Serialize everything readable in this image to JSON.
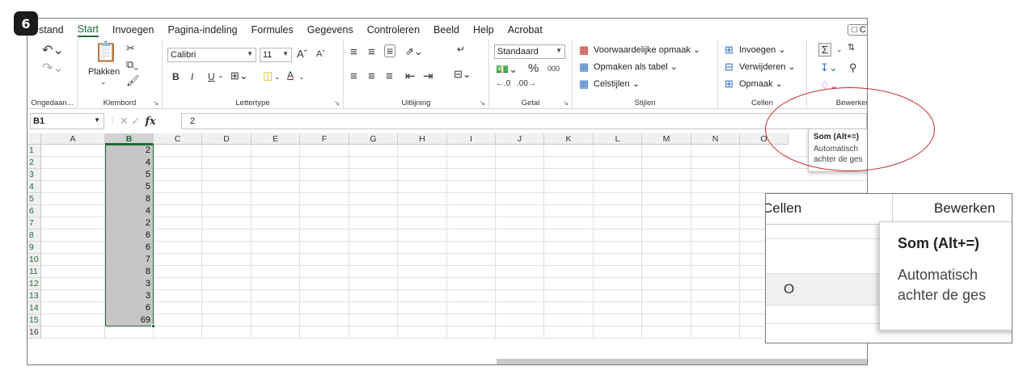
{
  "step_badge": "6",
  "tabs": [
    {
      "label": "stand"
    },
    {
      "label": "Start"
    },
    {
      "label": "Invoegen"
    },
    {
      "label": "Pagina-indeling"
    },
    {
      "label": "Formules"
    },
    {
      "label": "Gegevens"
    },
    {
      "label": "Controleren"
    },
    {
      "label": "Beeld"
    },
    {
      "label": "Help"
    },
    {
      "label": "Acrobat"
    }
  ],
  "comment_button": "C",
  "ribbon": {
    "undo_label": "Ongedaan...",
    "clipboard": {
      "paste_label": "Plakken",
      "group_label": "Klembord"
    },
    "font": {
      "name": "Calibri",
      "size": "11",
      "bold": "B",
      "italic": "I",
      "underline": "U",
      "font_color_letter": "A",
      "group_label": "Lettertype"
    },
    "alignment": {
      "group_label": "Uitlijning"
    },
    "number": {
      "format": "Standaard",
      "percent": "%",
      "thousands": "000",
      "group_label": "Getal"
    },
    "styles": {
      "conditional": "Voorwaardelijke opmaak",
      "as_table": "Opmaken als tabel",
      "cell_styles": "Celstijlen",
      "group_label": "Stijlen"
    },
    "cells": {
      "insert": "Invoegen",
      "delete": "Verwijderen",
      "format": "Opmaak",
      "group_label": "Cellen"
    },
    "editing": {
      "group_label": "Bewerken",
      "sum_symbol": "Σ"
    }
  },
  "formula_bar": {
    "name_box": "B1",
    "fx": "fx",
    "value": "2"
  },
  "columns": [
    "A",
    "B",
    "C",
    "D",
    "E",
    "F",
    "G",
    "H",
    "I",
    "J",
    "K",
    "L",
    "M",
    "N",
    "O"
  ],
  "rows": [
    "1",
    "2",
    "3",
    "4",
    "5",
    "6",
    "7",
    "8",
    "9",
    "10",
    "11",
    "12",
    "13",
    "14",
    "15",
    "16"
  ],
  "column_b_values": [
    "2",
    "4",
    "5",
    "5",
    "8",
    "4",
    "2",
    "6",
    "6",
    "7",
    "8",
    "3",
    "3",
    "6",
    "69"
  ],
  "tooltip": {
    "title": "Som (Alt+=)",
    "line1": "Automatisch",
    "line2": "achter de ges"
  },
  "zoom": {
    "cellen": "Cellen",
    "bewerken": "Bewerken",
    "column_letter": "O",
    "tip_title": "Som (Alt+=)",
    "tip_line1": "Automatisch",
    "tip_line2": "achter de ges"
  },
  "colors": {
    "accent_green": "#1e6b3a",
    "highlight_red": "#c8262a",
    "selection_gray": "#c6c6c6"
  }
}
